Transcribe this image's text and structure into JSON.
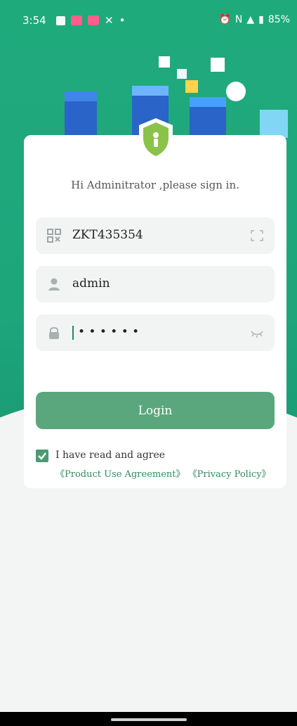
{
  "status": {
    "time": "3:54",
    "right_text": "85%"
  },
  "greeting": "Hi Adminitrator ,please sign in.",
  "fields": {
    "server_id": "ZKT435354",
    "username": "admin",
    "password_masked": "• • • • • •"
  },
  "login_button": "Login",
  "agreement": {
    "text": "I have read and agree",
    "product_agreement": "《Product Use Agreement》",
    "privacy_policy": "《Privacy Policy》"
  },
  "colors": {
    "brand": "#1faa7c",
    "button": "#5aa77d"
  }
}
